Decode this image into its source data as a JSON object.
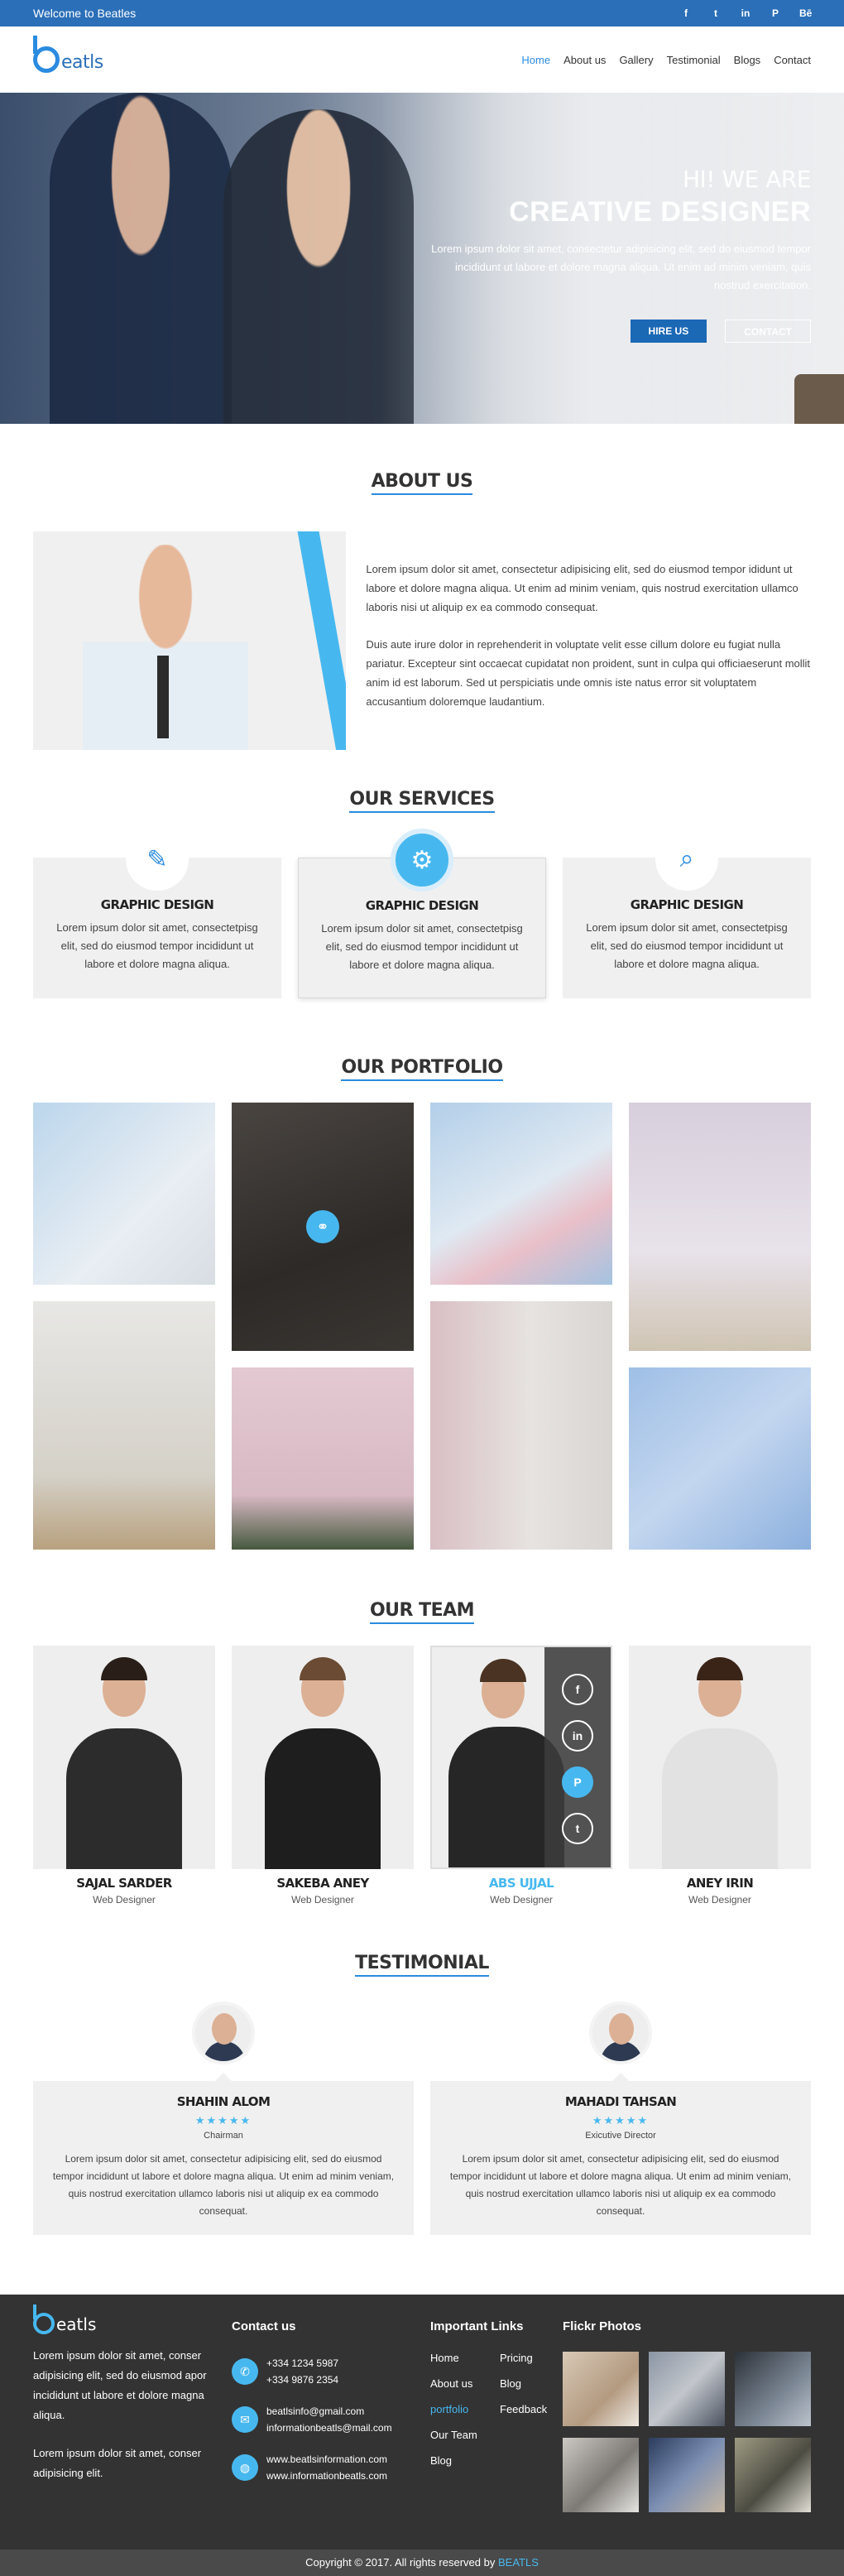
{
  "topbar": {
    "welcome": "Welcome to Beatles",
    "social": [
      {
        "icon": "facebook-icon",
        "glyph": "f"
      },
      {
        "icon": "twitter-icon",
        "glyph": "t"
      },
      {
        "icon": "linkedin-icon",
        "glyph": "in"
      },
      {
        "icon": "pinterest-icon",
        "glyph": "P"
      },
      {
        "icon": "behance-icon",
        "glyph": "Bē"
      }
    ]
  },
  "header": {
    "logo": "eatls",
    "nav": [
      "Home",
      "About us",
      "Gallery",
      "Testimonial",
      "Blogs",
      "Contact"
    ]
  },
  "hero": {
    "greeting": "HI! WE ARE",
    "headline": "CREATIVE DESIGNER",
    "description": "Lorem ipsum dolor sit amet, consectetur adipisicing elit, sed do eiusmod tempor incididunt ut labore et dolore magna aliqua. Ut enim ad minim veniam, quis nostrud exercitation.",
    "hire_button": "HIRE US",
    "contact_button": "CONTACT"
  },
  "about": {
    "title": "ABOUT US",
    "p1": "Lorem ipsum dolor sit amet, consectetur adipisicing elit, sed do eiusmod tempor ididunt ut labore et dolore magna aliqua. Ut enim ad minim veniam, quis nostrud exercitation ullamco laboris nisi ut aliquip ex ea commodo consequat.",
    "p2": "Duis aute irure dolor in reprehenderit in voluptate velit esse cillum dolore eu fugiat nulla pariatur. Excepteur sint occaecat cupidatat non proident, sunt in culpa qui officiaeserunt mollit anim id est laborum. Sed ut perspiciatis unde omnis iste natus error sit voluptatem accusantium doloremque laudantium."
  },
  "services": {
    "title": "OUR SERVICES",
    "items": [
      {
        "title": "GRAPHIC DESIGN",
        "text": "Lorem ipsum dolor sit amet, consectetpisg elit, sed do eiusmod tempor incididunt ut labore et dolore magna aliqua.",
        "icon": "pen-tool-icon",
        "glyph": "✎"
      },
      {
        "title": "GRAPHIC DESIGN",
        "text": "Lorem ipsum dolor sit amet, consectetpisg elit, sed do eiusmod tempor incididunt ut labore et dolore magna aliqua.",
        "icon": "monitor-gear-icon",
        "glyph": "⚙"
      },
      {
        "title": "GRAPHIC DESIGN",
        "text": "Lorem ipsum dolor sit amet, consectetpisg elit, sed do eiusmod tempor incididunt ut labore et dolore magna aliqua.",
        "icon": "magnifier-icon",
        "glyph": "⌕"
      }
    ]
  },
  "portfolio": {
    "title": "OUR PORTFOLIO",
    "link_icon": "link-icon",
    "link_glyph": "⚭"
  },
  "team": {
    "title": "OUR TEAM",
    "members": [
      {
        "name": "SAJAL SARDER",
        "role": "Web Designer"
      },
      {
        "name": "SAKEBA ANEY",
        "role": "Web Designer"
      },
      {
        "name": "ABS UJJAL",
        "role": "Web Designer"
      },
      {
        "name": "ANEY IRIN",
        "role": "Web Designer"
      }
    ],
    "overlay": [
      {
        "icon": "facebook-icon",
        "glyph": "f"
      },
      {
        "icon": "linkedin-icon",
        "glyph": "in"
      },
      {
        "icon": "pinterest-icon",
        "glyph": "P"
      },
      {
        "icon": "twitter-icon",
        "glyph": "t"
      }
    ]
  },
  "testimonial": {
    "title": "TESTIMONIAL",
    "items": [
      {
        "name": "SHAHIN ALOM",
        "stars": "★★★★★",
        "role": "Chairman",
        "text": "Lorem ipsum dolor sit amet, consectetur adipisicing elit, sed do eiusmod tempor incididunt ut labore et dolore magna aliqua. Ut enim ad minim veniam, quis nostrud exercitation ullamco laboris nisi ut aliquip ex ea commodo consequat."
      },
      {
        "name": "MAHADI TAHSAN",
        "stars": "★★★★★",
        "role": "Exicutive Director",
        "text": "Lorem ipsum dolor sit amet, consectetur adipisicing elit, sed do eiusmod tempor incididunt ut labore et dolore magna aliqua. Ut enim ad minim veniam, quis nostrud exercitation ullamco laboris nisi ut aliquip ex ea commodo consequat."
      }
    ]
  },
  "footer": {
    "logo": "eatls",
    "about_p1": "Lorem ipsum dolor sit amet, conser adipisicing elit, sed do eiusmod apor incididunt ut labore et dolore magna aliqua.",
    "about_p2": "Lorem ipsum dolor sit amet, conser adipisicing elit.",
    "contact_title": "Contact us",
    "phones": [
      "+334 1234 5987",
      "+334 9876 2354"
    ],
    "emails": [
      "beatlsinfo@gmail.com",
      "informationbeatls@mail.com"
    ],
    "webs": [
      "www.beatlsinformation.com",
      "www.informationbeatls.com"
    ],
    "links_title": "Important Links",
    "links": [
      "Home",
      "Pricing",
      "About us",
      "Blog",
      "portfolio",
      "Feedback",
      "Our Team",
      "",
      "Blog",
      ""
    ],
    "flickr_title": "Flickr Photos",
    "copyright_pre": "Copyright © 2017. All rights reserved by",
    "copyright_brand": "BEATLS"
  },
  "colors": {
    "primary": "#2a6fb8",
    "accent": "#47b8ef",
    "footer_bg": "#333333"
  }
}
